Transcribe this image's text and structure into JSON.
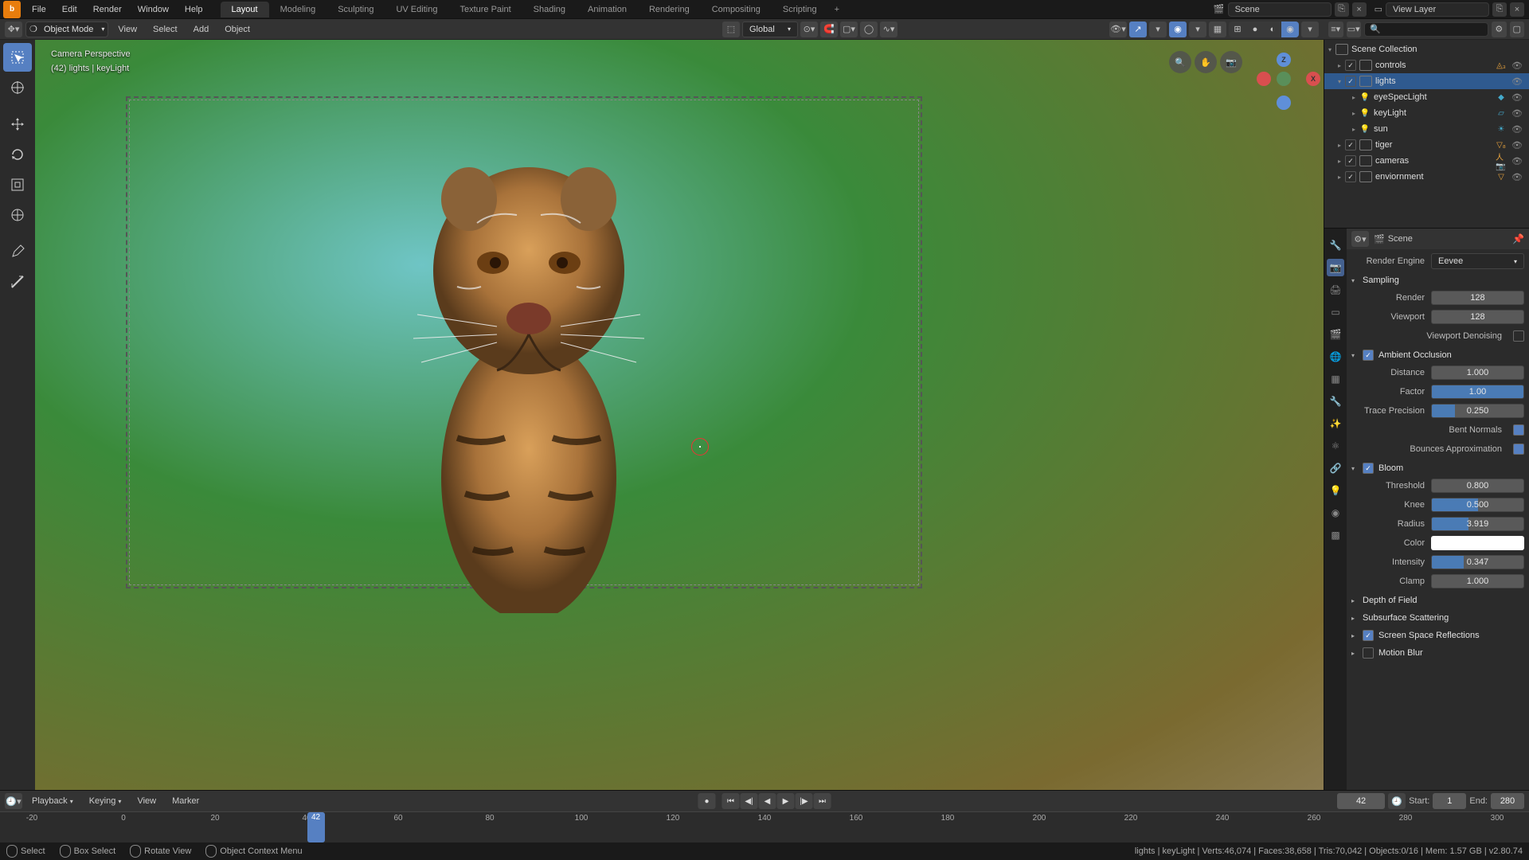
{
  "menus": {
    "file": "File",
    "edit": "Edit",
    "render": "Render",
    "window": "Window",
    "help": "Help"
  },
  "tabs": [
    "Layout",
    "Modeling",
    "Sculpting",
    "UV Editing",
    "Texture Paint",
    "Shading",
    "Animation",
    "Rendering",
    "Compositing",
    "Scripting"
  ],
  "active_tab": "Layout",
  "scene_name": "Scene",
  "view_layer": "View Layer",
  "mode": "Object Mode",
  "hdr_menus": {
    "view": "View",
    "select": "Select",
    "add": "Add",
    "object": "Object"
  },
  "orientation": "Global",
  "vp": {
    "title": "Camera Perspective",
    "sub": "(42) lights | keyLight"
  },
  "outliner": {
    "root": "Scene Collection",
    "items": [
      {
        "name": "controls",
        "type": "coll",
        "depth": 1
      },
      {
        "name": "lights",
        "type": "coll",
        "depth": 1,
        "sel": true,
        "open": true
      },
      {
        "name": "eyeSpecLight",
        "type": "light",
        "depth": 2
      },
      {
        "name": "keyLight",
        "type": "light",
        "depth": 2
      },
      {
        "name": "sun",
        "type": "light",
        "depth": 2
      },
      {
        "name": "tiger",
        "type": "coll",
        "depth": 1,
        "badge": "8"
      },
      {
        "name": "cameras",
        "type": "coll",
        "depth": 1
      },
      {
        "name": "enviornment",
        "type": "coll",
        "depth": 1
      }
    ]
  },
  "props": {
    "context": "Scene",
    "engine_label": "Render Engine",
    "engine": "Eevee",
    "sampling": {
      "title": "Sampling",
      "render_label": "Render",
      "render": "128",
      "viewport_label": "Viewport",
      "viewport": "128",
      "denoise_label": "Viewport Denoising"
    },
    "ao": {
      "title": "Ambient Occlusion",
      "distance_label": "Distance",
      "distance": "1.000",
      "factor_label": "Factor",
      "factor": "1.00",
      "factor_fill": 100,
      "trace_label": "Trace Precision",
      "trace": "0.250",
      "trace_fill": 25,
      "bent_label": "Bent Normals",
      "bounces_label": "Bounces Approximation"
    },
    "bloom": {
      "title": "Bloom",
      "threshold_label": "Threshold",
      "threshold": "0.800",
      "knee_label": "Knee",
      "knee": "0.500",
      "knee_fill": 50,
      "radius_label": "Radius",
      "radius": "3.919",
      "radius_fill": 40,
      "color_label": "Color",
      "intensity_label": "Intensity",
      "intensity": "0.347",
      "intensity_fill": 35,
      "clamp_label": "Clamp",
      "clamp": "1.000"
    },
    "dof": "Depth of Field",
    "sss": "Subsurface Scattering",
    "ssr": "Screen Space Reflections",
    "mblur": "Motion Blur"
  },
  "timeline": {
    "menus": {
      "playback": "Playback",
      "keying": "Keying",
      "view": "View",
      "marker": "Marker"
    },
    "current": "42",
    "start_label": "Start:",
    "start": "1",
    "end_label": "End:",
    "end": "280",
    "ticks": [
      -20,
      0,
      20,
      40,
      60,
      80,
      100,
      120,
      140,
      160,
      180,
      200,
      220,
      240,
      260,
      280,
      300
    ]
  },
  "status": {
    "select": "Select",
    "box": "Box Select",
    "rotate": "Rotate View",
    "ctx": "Object Context Menu",
    "right": "lights | keyLight | Verts:46,074 | Faces:38,658 | Tris:70,042 | Objects:0/16 | Mem: 1.57 GB | v2.80.74"
  }
}
